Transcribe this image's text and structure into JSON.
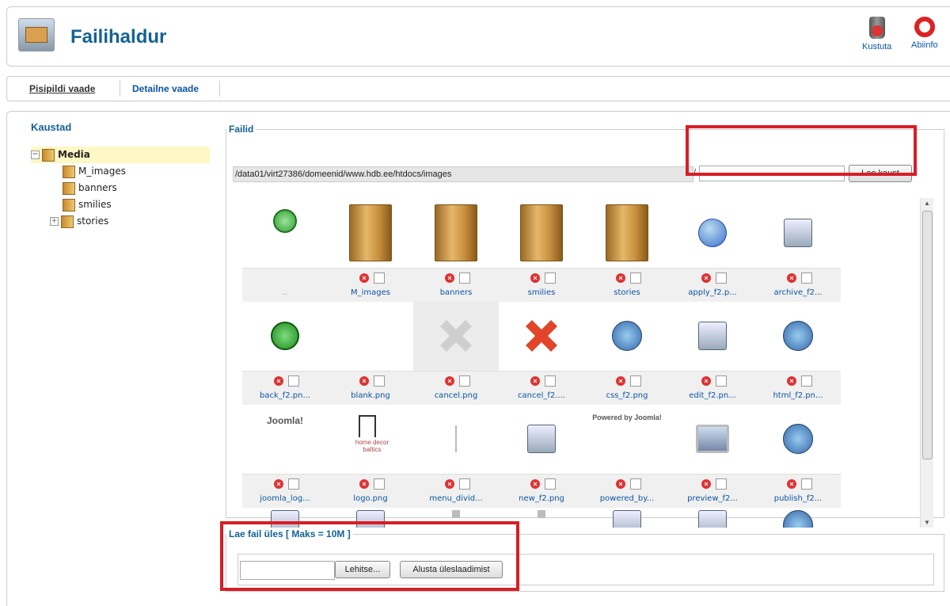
{
  "header": {
    "title": "Failihaldur",
    "delete_label": "Kustuta",
    "help_label": "Abiinfo"
  },
  "tabs": {
    "thumbnail": "Pisipildi vaade",
    "detail": "Detailne vaade"
  },
  "folders": {
    "title": "Kaustad",
    "items": [
      {
        "label": "Media"
      },
      {
        "label": "M_images"
      },
      {
        "label": "banners"
      },
      {
        "label": "smilies"
      },
      {
        "label": "stories"
      }
    ]
  },
  "files": {
    "legend": "Failid",
    "path": "/data01/virt27386/domeenid/www.hdb.ee/htdocs/images",
    "separator": "/",
    "create_folder_button": "Loo kaust",
    "up_label": "..",
    "items": [
      {
        "name": "M_images",
        "icon": "folder-icon"
      },
      {
        "name": "banners",
        "icon": "folder-icon"
      },
      {
        "name": "smilies",
        "icon": "folder-icon"
      },
      {
        "name": "stories",
        "icon": "folder-icon"
      },
      {
        "name": "apply_f2.p...",
        "icon": "check-icon"
      },
      {
        "name": "archive_f2...",
        "icon": "archive-icon"
      },
      {
        "name": "back_f2.pn...",
        "icon": "back-arrow-icon"
      },
      {
        "name": "blank.png",
        "icon": "blank-icon"
      },
      {
        "name": "cancel.png",
        "icon": "cancel-grey-icon"
      },
      {
        "name": "cancel_f2....",
        "icon": "cancel-red-icon"
      },
      {
        "name": "css_f2.png",
        "icon": "css-globe-icon"
      },
      {
        "name": "edit_f2.pn...",
        "icon": "edit-icon"
      },
      {
        "name": "html_f2.pn...",
        "icon": "html-globe-icon"
      },
      {
        "name": "joomla_log...",
        "icon": "joomla-logo-icon"
      },
      {
        "name": "logo.png",
        "icon": "hdb-logo-icon"
      },
      {
        "name": "menu_divid...",
        "icon": "divider-icon"
      },
      {
        "name": "new_f2.png",
        "icon": "new-icon"
      },
      {
        "name": "powered_by...",
        "icon": "powered-by-icon"
      },
      {
        "name": "preview_f2...",
        "icon": "monitor-icon"
      },
      {
        "name": "publish_f2...",
        "icon": "publish-globe-icon"
      }
    ]
  },
  "upload": {
    "legend": "Lae fail üles [ Maks = 10M ]",
    "browse_button": "Lehitse...",
    "start_button": "Alusta üleslaadimist"
  },
  "logo_texts": {
    "joomla": "Joomla!",
    "powered": "Powered by Joomla!"
  },
  "colors": {
    "link": "#146295",
    "highlight_box": "#d81e27"
  }
}
